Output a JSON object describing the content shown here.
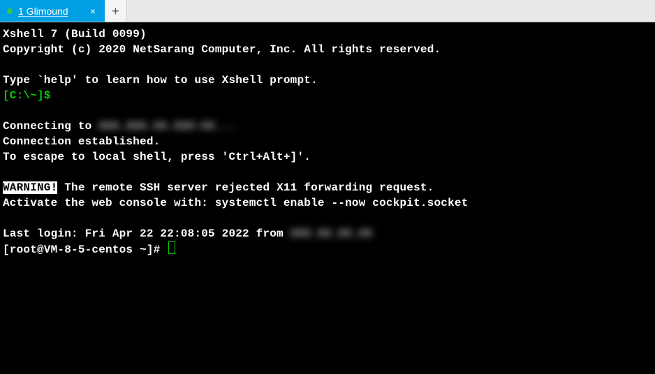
{
  "tabs": {
    "active": {
      "label": "1 Glimound"
    },
    "newtab_glyph": "+"
  },
  "terminal": {
    "banner_line1": "Xshell 7 (Build 0099)",
    "banner_line2": "Copyright (c) 2020 NetSarang Computer, Inc. All rights reserved.",
    "help_line": "Type `help' to learn how to use Xshell prompt.",
    "local_prompt": "[C:\\~]$",
    "connecting_prefix": "Connecting to ",
    "connecting_host_blurred": "XXX.XXX.XX.XXX:XX...",
    "connected": "Connection established.",
    "escape_hint": "To escape to local shell, press 'Ctrl+Alt+]'.",
    "warning_label": "WARNING!",
    "warning_rest": " The remote SSH server rejected X11 forwarding request.",
    "activate_line": "Activate the web console with: systemctl enable --now cockpit.socket",
    "last_login_prefix": "Last login: Fri Apr 22 22:08:05 2022 from ",
    "last_login_ip_blurred": "XXX.XX.XX.XX",
    "remote_prompt": "[root@VM-8-5-centos ~]# "
  }
}
